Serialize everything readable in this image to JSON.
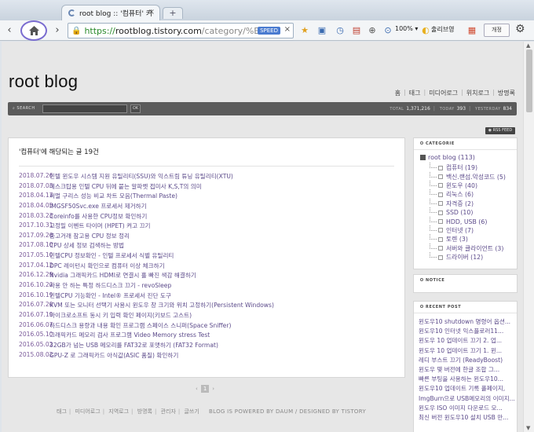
{
  "browser": {
    "tab_title": "root blog :: '컴퓨터' 키",
    "tab_close": "×",
    "new_tab": "+",
    "url_scheme": "https://",
    "url_host": "rootblog.tistory.com",
    "url_path": "/category/%EC",
    "speed_badge": "SPEED",
    "url_clear": "×",
    "zoom": "100%",
    "zoom_arrow": "▾",
    "extension_label": "출리브영",
    "profile_button": "개정",
    "back": "‹",
    "forward": "›"
  },
  "blog": {
    "title": "root blog",
    "nav": [
      "홈",
      "태그",
      "미디어로그",
      "위치로그",
      "방명록"
    ],
    "search_label": "SEARCH",
    "search_ok": "OK",
    "stats": {
      "total_label": "TOTAL",
      "total": "1,371,216",
      "today_label": "TODAY",
      "today": "393",
      "yesterday_label": "YESTERDAY",
      "yesterday": "834"
    },
    "rss": "RSS FEED"
  },
  "main": {
    "heading": "'컴퓨터'에 해당되는 글 19건",
    "posts": [
      {
        "date": "2018.07.26",
        "title": "인텔 윈도우 시스템 지원 유틸리티(SSU)와 익스트림 튜닝 유틸리티(XTU)"
      },
      {
        "date": "2018.07.03",
        "title": "데스크탑용 인텔 CPU 뒤에 붙는 알파벳 접미사 K,S,T의 의미"
      },
      {
        "date": "2018.04.17",
        "title": "써멀 구리스 성능 비교 차트 모음(Thermal Paste)"
      },
      {
        "date": "2018.04.05",
        "title": "IMGSF50Svc.exe 프로세서 제거하기"
      },
      {
        "date": "2018.03.23",
        "title": "Coreinfo를 사용한 CPU정보 확인하기"
      },
      {
        "date": "2017.10.31",
        "title": "고정밀 이벤트 타이머 (HPET) 켜고 끄기"
      },
      {
        "date": "2017.09.26",
        "title": "중고거래 참고용 CPU 정보 정리"
      },
      {
        "date": "2017.08.10",
        "title": "CPU 상세 정보 검색하는 방법"
      },
      {
        "date": "2017.05.10",
        "title": "인텔CPU 정보확인 - 인텔 프로세서 식별 유틸리티"
      },
      {
        "date": "2017.04.12",
        "title": "DPC 레이턴시 확인으로 컴퓨터 이상 체크하기"
      },
      {
        "date": "2016.12.29",
        "title": "Nvidia 그래픽카드 HDMI로 연결시 흘 빠진 색감 해결하기"
      },
      {
        "date": "2016.10.20",
        "title": "사용 안 하는 특정 하드디스크 끄기 - revoSleep"
      },
      {
        "date": "2016.10.19",
        "title": "인텔CPU 기능확인 - Intel® 프로세서 진단 도구"
      },
      {
        "date": "2016.07.20",
        "title": "KVM 또는 모니터 선택기 사용시 윈도우 창 크기와 위치 고정하기(Persistent Windows)"
      },
      {
        "date": "2016.07.19",
        "title": "마이크로소프트 동시 키 입력 확인 페이지(키보드 고스트)"
      },
      {
        "date": "2016.06.07",
        "title": "하드디스크 용량과 내용 확인 프로그램 스페이스 스니퍼(Space Sniffer)"
      },
      {
        "date": "2016.05.10",
        "title": "그래픽카드 메모리 검사 프로그램 Video Memory stress Test"
      },
      {
        "date": "2016.05.02",
        "title": "32GB가 넘는 USB 메모리를 FAT32로 포맷하기 (FAT32 Format)"
      },
      {
        "date": "2015.08.02",
        "title": "GPU-Z 로 그래픽카드 아식값(ASIC 품질) 확인하기"
      }
    ]
  },
  "pager": {
    "prev": "‹",
    "current": "1",
    "next": "›"
  },
  "footer": {
    "links": [
      "태그",
      "미디어로그",
      "지역로그",
      "방명록",
      "관리자",
      "글쓰기"
    ],
    "powered": "BLOG IS POWERED BY DAUM / DESIGNED BY TISTORY"
  },
  "sidebar": {
    "category_head": "CATEGORIE",
    "category_root": "root blog (113)",
    "categories": [
      "컴퓨터 (19)",
      "백신.랜섬.악성코드 (5)",
      "윈도우 (40)",
      "리눅스 (6)",
      "자격증 (2)",
      "SSD (10)",
      "HDD, USB (6)",
      "인터넷 (7)",
      "토렌 (3)",
      "서버와 클라이언트 (3)",
      "드라이버 (12)"
    ],
    "notice_head": "NOTICE",
    "recent_head": "RECENT POST",
    "recent_posts": [
      "윈도우10 shutdown 명령어 옵션...",
      "윈도우10 인터넷 익스플로러11...",
      "윈도우 10 업데이트 끄기 2. 업...",
      "윈도우 10 업데이트 끄기 1. 윈...",
      "레디 부스트 끄기 (ReadyBoost)",
      "윈도우 몇 버전에 한글 조합 그...",
      "빠른 부팅을 사용하는 윈도우10...",
      "윈도우10 업데이트 기록 폴페이지,",
      "ImgBurn으로 USB메모리의 이미지...",
      "윈도우 ISO 이미지 다운로드 모...",
      "최신 버전 윈도우10 설치 USB 만..."
    ]
  }
}
